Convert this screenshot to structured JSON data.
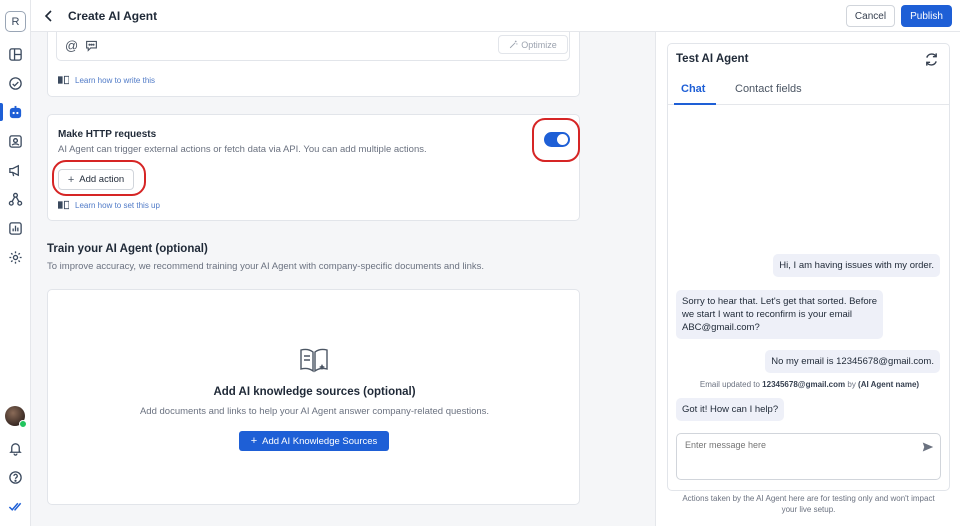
{
  "rail": {
    "workspace_initial": "R",
    "items": [
      "layout-icon",
      "inbox-icon",
      "ai-agent-icon",
      "contacts-icon",
      "megaphone-icon",
      "workflow-icon",
      "reports-icon",
      "settings-icon"
    ],
    "active_item": "ai-agent-icon",
    "bottom": [
      "avatar",
      "bell-icon",
      "help-icon",
      "double-check-icon"
    ]
  },
  "header": {
    "title": "Create AI Agent",
    "cancel_label": "Cancel",
    "publish_label": "Publish"
  },
  "instructions": {
    "optimize_label": "Optimize",
    "learn_link": "Learn how to write this"
  },
  "http": {
    "title": "Make HTTP requests",
    "description": "AI Agent can trigger external actions or fetch data via API. You can add multiple actions.",
    "enabled": true,
    "add_action_label": "Add action",
    "learn_link": "Learn how to set this up"
  },
  "train": {
    "title": "Train your AI Agent (optional)",
    "subtitle": "To improve accuracy, we recommend training your AI Agent with company-specific documents and links."
  },
  "knowledge": {
    "title": "Add AI knowledge sources (optional)",
    "subtitle": "Add documents and links to help your AI Agent answer company-related questions.",
    "button_label": "Add AI Knowledge Sources"
  },
  "test_panel": {
    "title": "Test AI Agent",
    "tabs": [
      {
        "label": "Chat",
        "active": true
      },
      {
        "label": "Contact fields",
        "active": false
      }
    ],
    "messages": [
      {
        "from": "user",
        "lines": [
          "Hi, I am having issues with my order."
        ]
      },
      {
        "from": "agent",
        "lines": [
          "Sorry to hear that. Let's get that sorted. Before",
          "we start I want to reconfirm is your email",
          "ABC@gmail.com?"
        ]
      },
      {
        "from": "user",
        "lines": [
          "No my email is 12345678@gmail.com."
        ]
      },
      {
        "from": "agent",
        "lines": [
          "Got it! How can I help?"
        ]
      }
    ],
    "system_note": {
      "prefix": "Email updated to ",
      "value": "12345678@gmail.com",
      "middle": " by ",
      "actor": "(AI Agent name)"
    },
    "composer_placeholder": "Enter message here",
    "disclaimer_line1": "Actions taken by the AI Agent here are for testing only and won't impact",
    "disclaimer_line2": "your live setup."
  },
  "colors": {
    "accent": "#1e5fd6",
    "highlight_ring": "#d62525",
    "online": "#22c55e"
  }
}
